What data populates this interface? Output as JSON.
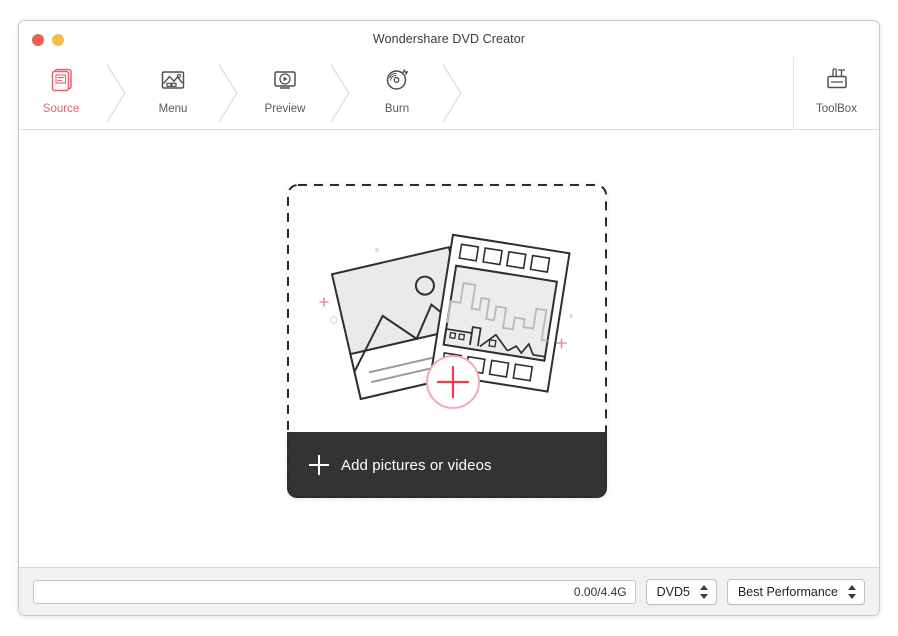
{
  "window": {
    "title": "Wondershare DVD Creator",
    "traffic_lights": [
      {
        "name": "close",
        "color": "#ef5f56"
      },
      {
        "name": "minimize",
        "color": "#f4bd4f"
      }
    ]
  },
  "toolbar": {
    "steps": [
      {
        "label": "Source",
        "icon": "document-stack-icon",
        "active": true
      },
      {
        "label": "Menu",
        "icon": "picture-frame-icon",
        "active": false
      },
      {
        "label": "Preview",
        "icon": "monitor-play-icon",
        "active": false
      },
      {
        "label": "Burn",
        "icon": "disc-flame-icon",
        "active": false
      }
    ],
    "toolbox": {
      "label": "ToolBox",
      "icon": "toolbox-icon"
    },
    "active_color": "#e8616e",
    "inactive_color": "#555a5f"
  },
  "main": {
    "drop_card": {
      "illustration": "photo-and-filmstrip-illustration",
      "add_plus_icon": "plus-circle-icon",
      "add_label": "Add pictures or videos",
      "add_bar_color": "#333333",
      "accent_color": "#e8616e"
    }
  },
  "bottom": {
    "progress": {
      "value": 0,
      "text": "0.00/4.4G"
    },
    "disc_type": {
      "value": "DVD5"
    },
    "quality": {
      "value": "Best Performance"
    }
  }
}
